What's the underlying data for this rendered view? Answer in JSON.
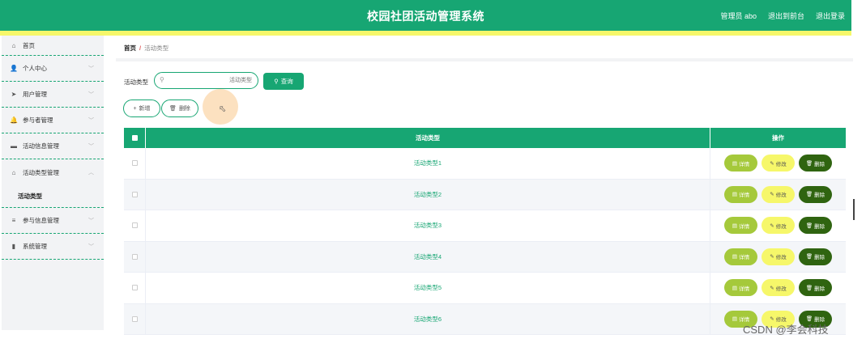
{
  "header": {
    "title": "校园社团活动管理系统",
    "user": "管理员 abo",
    "front": "退出到前台",
    "logout": "退出登录"
  },
  "sidebar": {
    "items": [
      {
        "label": "首页",
        "icon": "home-icon",
        "glyph": "⌂",
        "chevron": ""
      },
      {
        "label": "个人中心",
        "icon": "user-icon",
        "glyph": "👤",
        "chevron": "﹀"
      },
      {
        "label": "用户管理",
        "icon": "send-icon",
        "glyph": "➤",
        "chevron": "﹀"
      },
      {
        "label": "参与者管理",
        "icon": "bell-icon",
        "glyph": "🔔",
        "chevron": "﹀"
      },
      {
        "label": "活动信息管理",
        "icon": "card-icon",
        "glyph": "▬",
        "chevron": "﹀"
      },
      {
        "label": "活动类型管理",
        "icon": "bank-icon",
        "glyph": "⌂",
        "chevron": "︿"
      }
    ],
    "submenu": "活动类型",
    "items2": [
      {
        "label": "参与信息管理",
        "icon": "list-icon",
        "glyph": "≡",
        "chevron": "﹀"
      },
      {
        "label": "系统管理",
        "icon": "chart-icon",
        "glyph": "▮",
        "chevron": "﹀"
      }
    ]
  },
  "breadcrumb": {
    "home": "首页",
    "sep": "/",
    "current": "活动类型"
  },
  "search": {
    "label": "活动类型",
    "placeholder": "活动类型",
    "button": "查询"
  },
  "actions": {
    "add": "新增",
    "delete": "删除"
  },
  "table": {
    "headers": [
      "活动类型",
      "操作"
    ],
    "rows": [
      "活动类型1",
      "活动类型2",
      "活动类型3",
      "活动类型4",
      "活动类型5",
      "活动类型6"
    ],
    "buttons": {
      "detail": "详情",
      "edit": "修改",
      "delete": "删除"
    }
  },
  "watermark": "CSDN @李会科技",
  "colors": {
    "primary": "#17a673",
    "accent_yellow": "#f6f76a",
    "detail": "#a5c93b",
    "delete": "#2f6410"
  }
}
